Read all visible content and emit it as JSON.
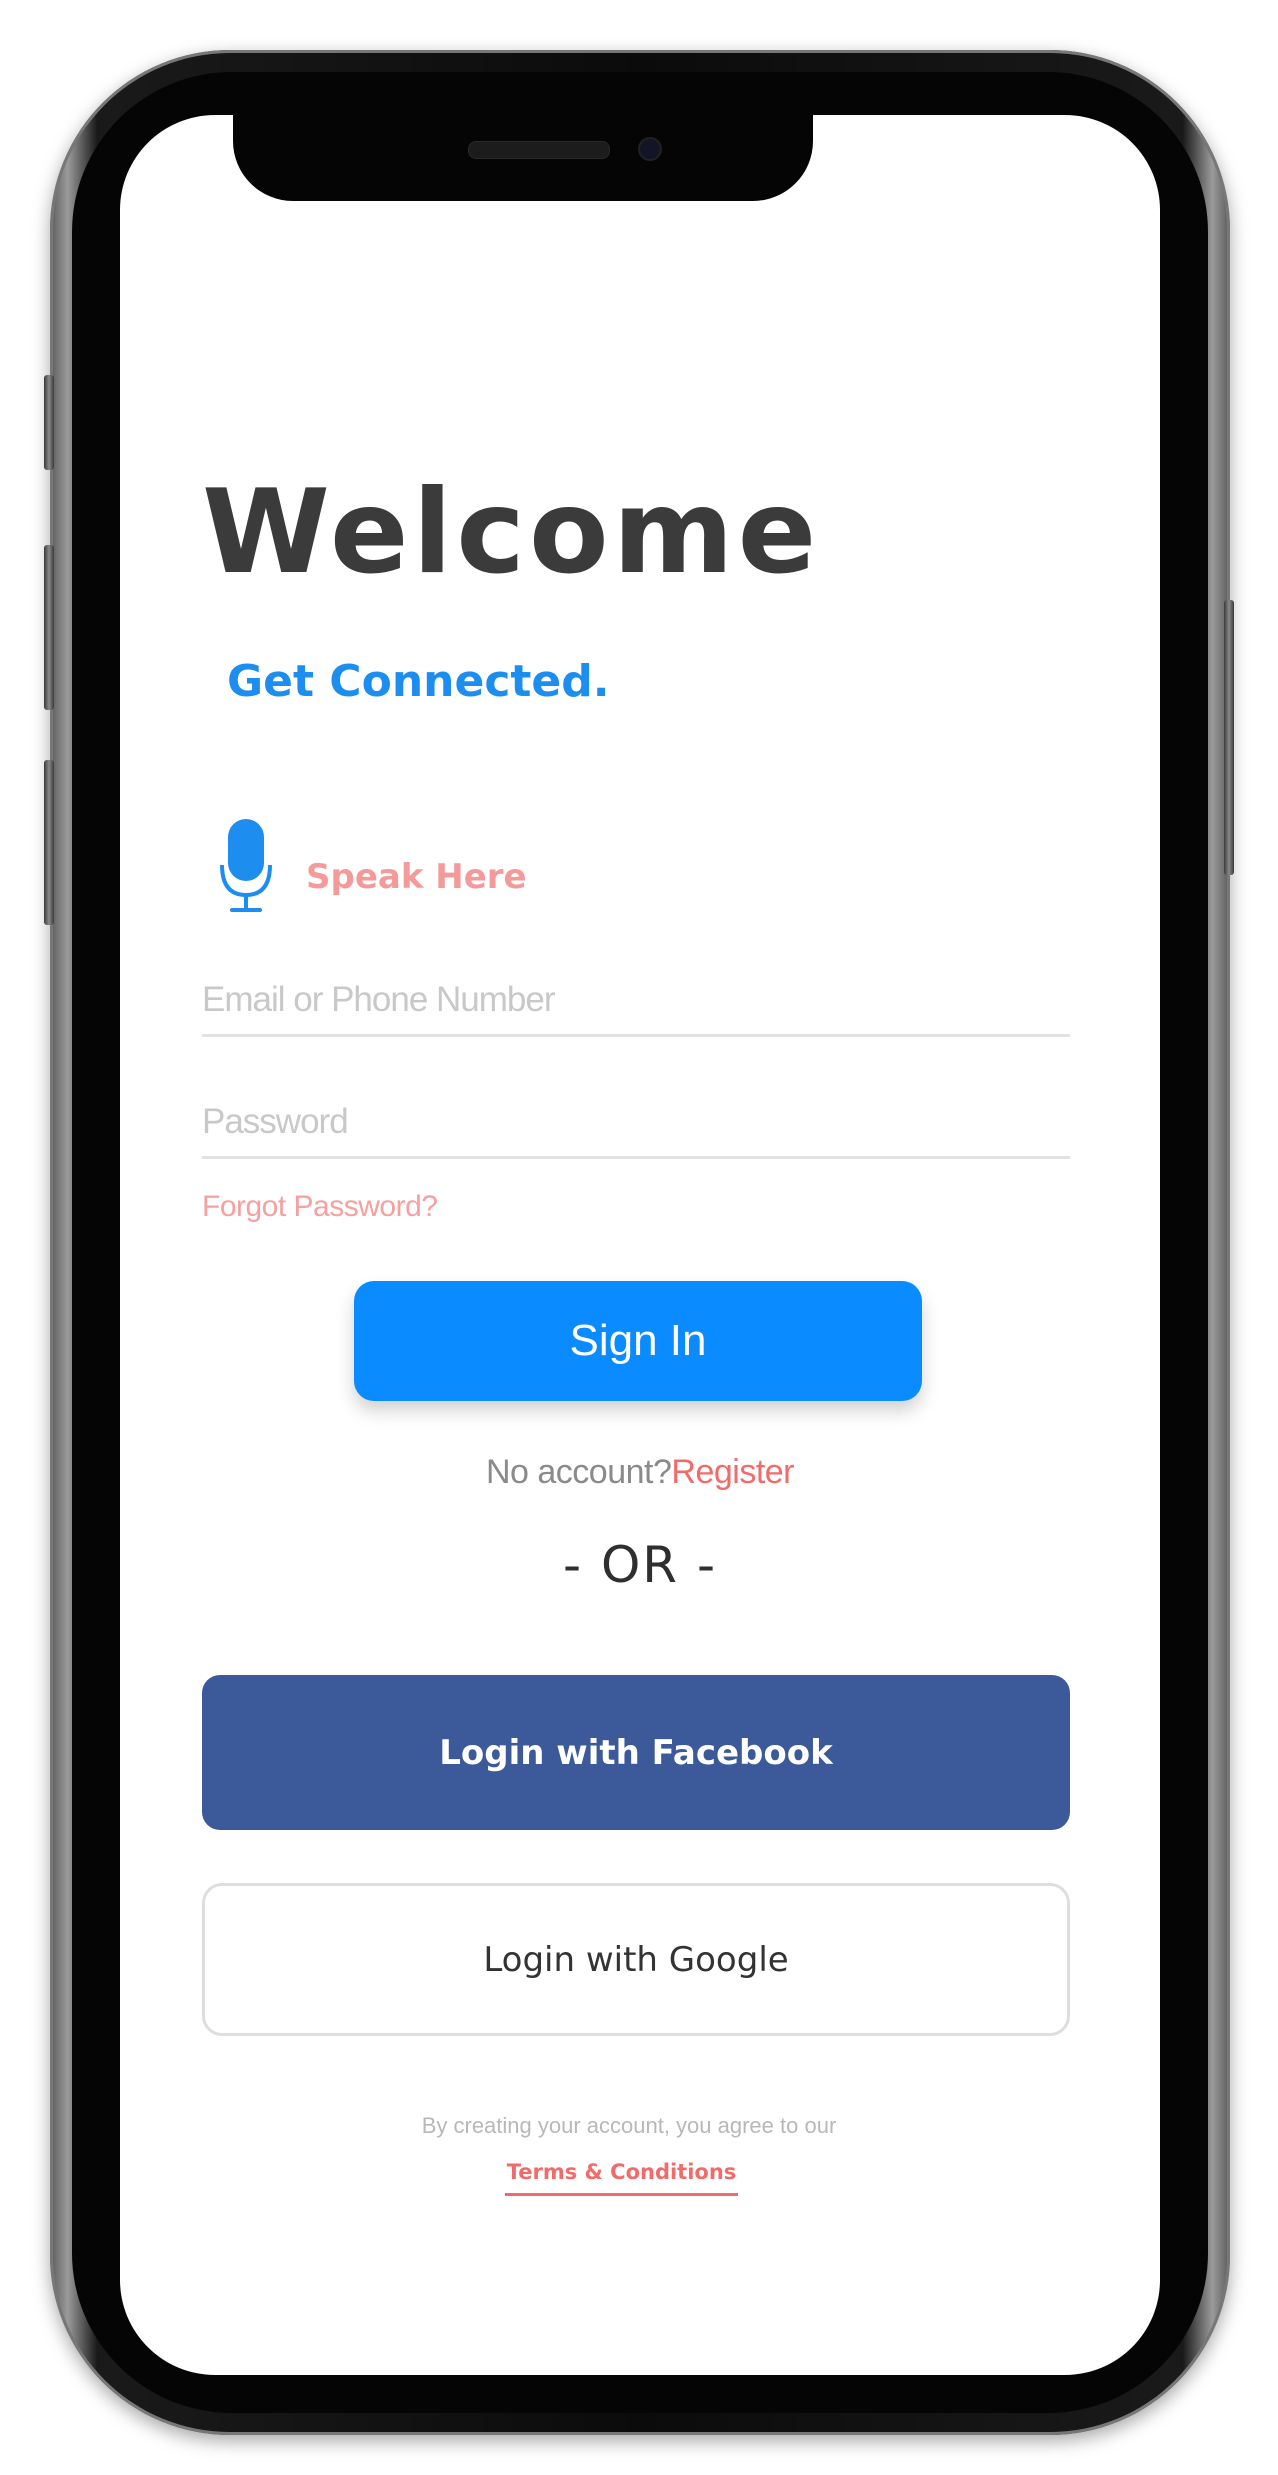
{
  "colors": {
    "title": "#3b3b3b",
    "accent_blue": "#1e8df0",
    "sign_in_bg": "#0a8bff",
    "facebook_bg": "#3c5a9a",
    "link_red": "#f26b6b",
    "speak_pink": "#f59a9a"
  },
  "login": {
    "title": "Welcome",
    "subtitle": "Get Connected.",
    "voice": {
      "icon": "microphone-icon",
      "label": "Speak Here"
    },
    "email_placeholder": "Email or Phone Number",
    "email_value": "",
    "password_placeholder": "Password",
    "password_value": "",
    "forgot_password": "Forgot Password?",
    "sign_in_label": "Sign In",
    "no_account_text": "No account?",
    "register_link": "Register",
    "or_separator": "- OR -",
    "facebook_label": "Login with Facebook",
    "google_label": "Login with Google",
    "agreement_text": "By creating your account, you agree to our",
    "terms_link": "Terms & Conditions"
  }
}
